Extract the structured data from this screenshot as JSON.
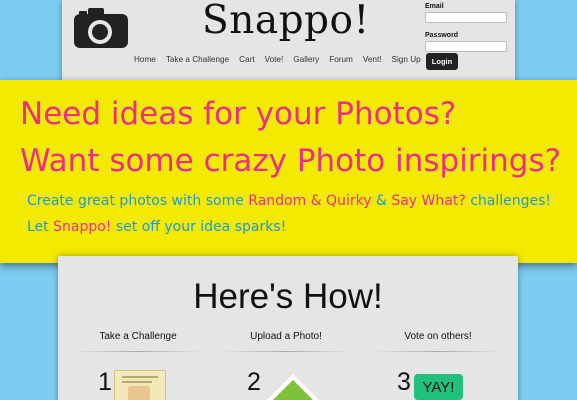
{
  "header": {
    "brand": "Snappo!",
    "camera_icon": "camera-icon",
    "nav": [
      "Home",
      "Take a Challenge",
      "Cart",
      "Vote!",
      "Gallery",
      "Forum",
      "Vent!",
      "Sign Up"
    ],
    "login": {
      "email_label": "Email",
      "password_label": "Password",
      "email_value": "",
      "password_value": "",
      "button_label": "Login"
    }
  },
  "banner": {
    "headline1": "Need ideas for your Photos?",
    "headline2": "Want some crazy Photo inspirings?",
    "sub1": {
      "a": "Create great photos with some ",
      "b": "Random & Quirky",
      "c": " & ",
      "d": "Say What?",
      "e": " challenges!"
    },
    "sub2": {
      "a": "Let ",
      "b": "Snappo!",
      "c": " set off your idea sparks!"
    }
  },
  "how": {
    "title": "Here's How!",
    "steps": [
      {
        "number": "1",
        "label": "Take a Challenge",
        "icon": "challenge-card-icon"
      },
      {
        "number": "2",
        "label": "Upload a Photo!",
        "icon": "upload-arrow-icon"
      },
      {
        "number": "3",
        "label": "Vote on others!",
        "badge": "YAY!"
      }
    ]
  },
  "colors": {
    "background": "#7dcdf2",
    "banner": "#f2ea00",
    "pink": "#ee2e86",
    "blue": "#1b9ad6",
    "panel": "#e5e5e5",
    "green": "#22c07a"
  }
}
